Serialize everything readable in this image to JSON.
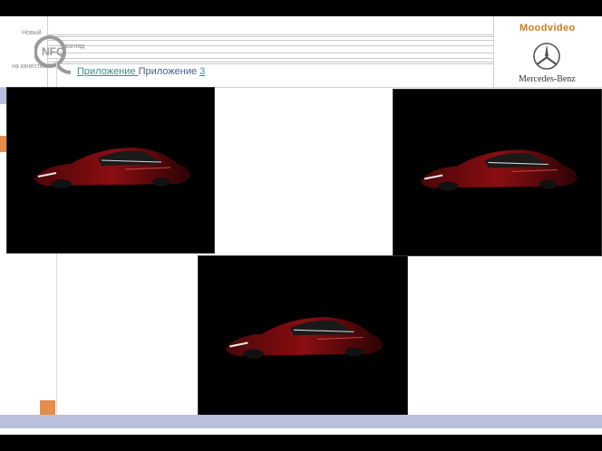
{
  "header": {
    "tagline_top": "Новый",
    "tagline_mid": "взгляд",
    "tagline_bottom": "на качество",
    "logo_letters": "NFQ",
    "breadcrumb": {
      "item1": "Приложение ",
      "item2": "Приложение ",
      "item3": "3"
    },
    "brand_title": "Moodvideo",
    "brand_name": "Mercedes-Benz"
  },
  "gallery": {
    "photos": [
      {
        "subject": "red car on black background"
      },
      {
        "subject": "red car on black background"
      },
      {
        "subject": "red car on black background"
      }
    ]
  },
  "colors": {
    "accent_orange": "#e48d4e",
    "accent_blue": "#b9bfdd",
    "brand_orange": "#d07a1e",
    "link_teal": "#3d8b8b",
    "link_blue": "#4a5d8f"
  }
}
